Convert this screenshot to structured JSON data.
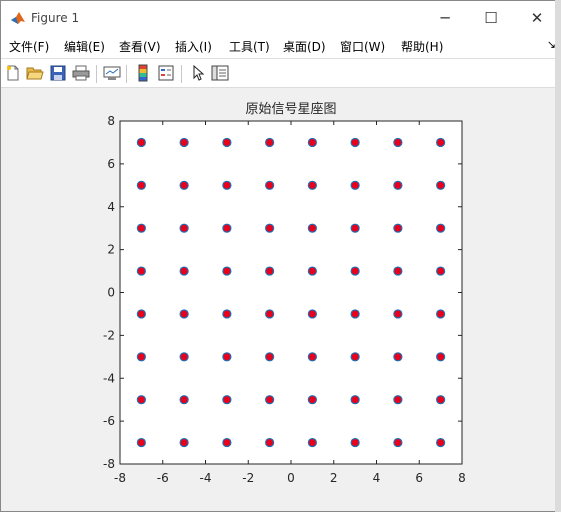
{
  "window": {
    "title": "Figure 1",
    "buttons": {
      "minimize": "─",
      "maximize": "☐",
      "close": "✕"
    }
  },
  "menu": {
    "items": [
      "文件(F)",
      "编辑(E)",
      "查看(V)",
      "插入(I)",
      "工具(T)",
      "桌面(D)",
      "窗口(W)",
      "帮助(H)"
    ],
    "overflow": "↘"
  },
  "toolbar": {
    "icons": [
      "new-figure-icon",
      "open-file-icon",
      "save-icon",
      "print-icon",
      "link-plot-icon",
      "colorbar-icon",
      "legend-icon",
      "pointer-icon",
      "property-inspector-icon"
    ]
  },
  "colors": {
    "marker_face": "#e8001c",
    "marker_edge": "#1f6fb2",
    "axes_bg": "#ffffff",
    "figure_bg": "#f0f0f0"
  },
  "chart_data": {
    "type": "scatter",
    "title": "原始信号星座图",
    "xlabel": "",
    "ylabel": "",
    "xlim": [
      -8,
      8
    ],
    "ylim": [
      -8,
      8
    ],
    "xticks": [
      "-8",
      "-6",
      "-4",
      "-2",
      "0",
      "2",
      "4",
      "6",
      "8"
    ],
    "yticks": [
      "8",
      "6",
      "4",
      "2",
      "0",
      "-2",
      "-4",
      "-6",
      "-8"
    ],
    "grid": false,
    "legend": "none",
    "points": {
      "x_levels": [
        -7,
        -5,
        -3,
        -1,
        1,
        3,
        5,
        7
      ],
      "y_levels": [
        -7,
        -5,
        -3,
        -1,
        1,
        3,
        5,
        7
      ]
    }
  }
}
